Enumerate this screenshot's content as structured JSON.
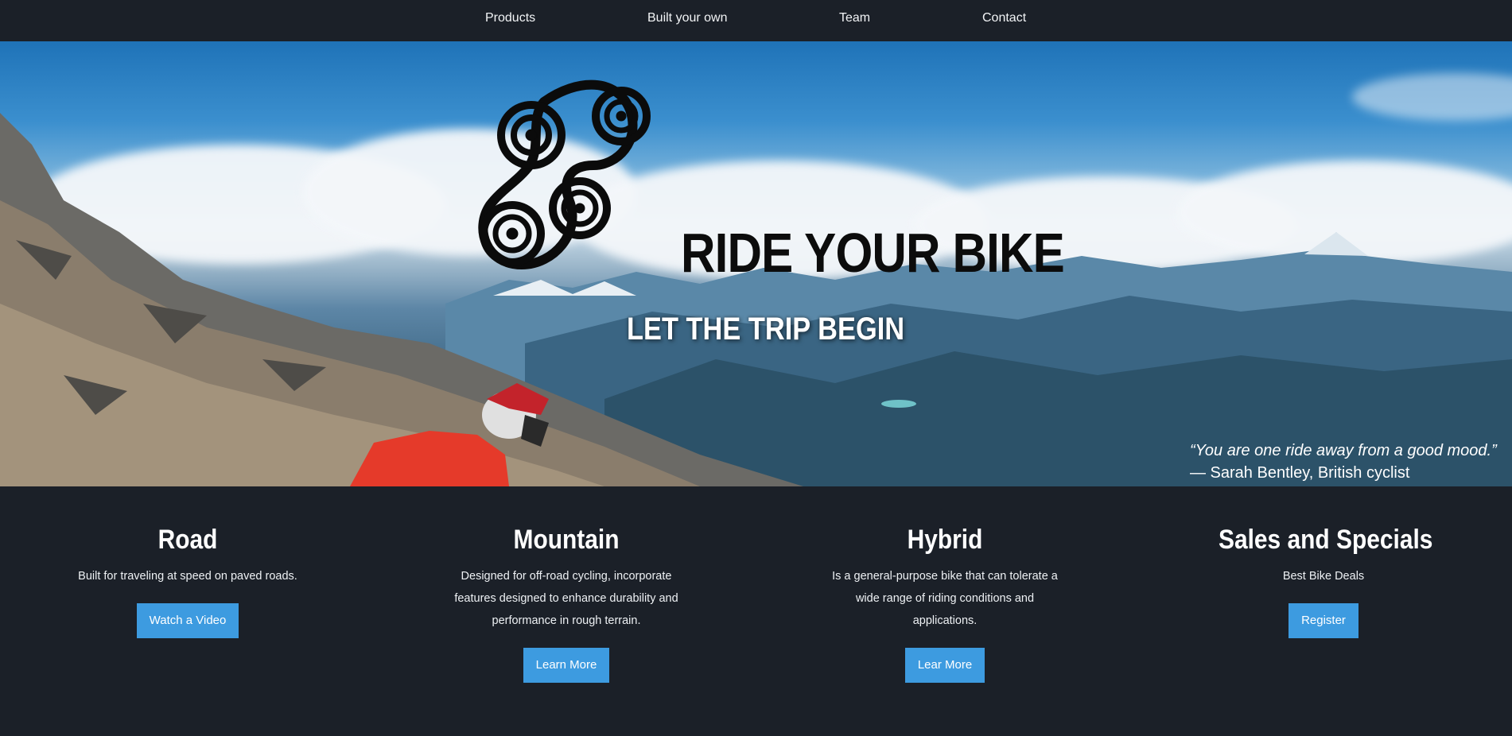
{
  "nav": {
    "items": [
      {
        "label": "Products"
      },
      {
        "label": "Built your own"
      },
      {
        "label": "Team"
      },
      {
        "label": "Contact"
      }
    ]
  },
  "hero": {
    "logo_icon": "bike-chain-icon",
    "title": "RIDE YOUR BIKE",
    "subtitle": "LET THE TRIP BEGIN",
    "quote": "“You are one ride away from a good mood.”",
    "quote_author": "— Sarah Bentley, British cyclist"
  },
  "categories": [
    {
      "title": "Road",
      "description": "Built for traveling at speed on paved roads.",
      "button": "Watch a Video"
    },
    {
      "title": "Mountain",
      "description": "Designed for off-road cycling, incorporate features designed to enhance durability and performance in rough terrain.",
      "button": "Learn More"
    },
    {
      "title": "Hybrid",
      "description": "Is a general-purpose bike that can tolerate a wide range of riding conditions and applications.",
      "button": "Lear More"
    },
    {
      "title": "Sales and Specials",
      "description": "Best Bike Deals",
      "button": "Register"
    }
  ],
  "colors": {
    "background": "#1b2028",
    "button": "#3d9be0",
    "text": "#ffffff"
  }
}
